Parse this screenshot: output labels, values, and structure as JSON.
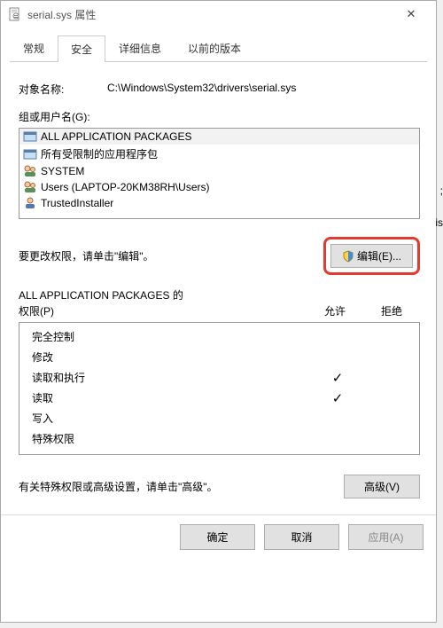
{
  "window": {
    "title": "serial.sys 属性"
  },
  "tabs": {
    "items": [
      {
        "label": "常规"
      },
      {
        "label": "安全"
      },
      {
        "label": "详细信息"
      },
      {
        "label": "以前的版本"
      }
    ],
    "active_index": 1
  },
  "security": {
    "object_label": "对象名称:",
    "object_path": "C:\\Windows\\System32\\drivers\\serial.sys",
    "groups_label": "组或用户名(G):",
    "groups": [
      {
        "name": "ALL APPLICATION PACKAGES",
        "icon": "rect"
      },
      {
        "name": "所有受限制的应用程序包",
        "icon": "rect"
      },
      {
        "name": "SYSTEM",
        "icon": "users"
      },
      {
        "name": "Users (LAPTOP-20KM38RH\\Users)",
        "icon": "users"
      },
      {
        "name": "TrustedInstaller",
        "icon": "user"
      }
    ],
    "edit_hint": "要更改权限，请单击\"编辑\"。",
    "edit_button": "编辑(E)...",
    "perm_title_prefix": "ALL APPLICATION PACKAGES 的",
    "perm_title_suffix": "权限(P)",
    "allow_label": "允许",
    "deny_label": "拒绝",
    "permissions": [
      {
        "name": "完全控制",
        "allow": false,
        "deny": false
      },
      {
        "name": "修改",
        "allow": false,
        "deny": false
      },
      {
        "name": "读取和执行",
        "allow": true,
        "deny": false
      },
      {
        "name": "读取",
        "allow": true,
        "deny": false
      },
      {
        "name": "写入",
        "allow": false,
        "deny": false
      },
      {
        "name": "特殊权限",
        "allow": false,
        "deny": false
      }
    ],
    "advanced_hint": "有关特殊权限或高级设置，请单击\"高级\"。",
    "advanced_button": "高级(V)"
  },
  "footer": {
    "ok": "确定",
    "cancel": "取消",
    "apply": "应用(A)"
  },
  "side": {
    "mark1": ";",
    "mark2": "is"
  }
}
